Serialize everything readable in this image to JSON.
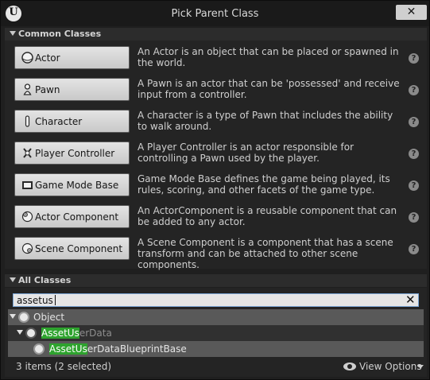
{
  "window": {
    "title": "Pick Parent Class",
    "close_glyph": "✕"
  },
  "icons": {
    "logo": "unreal-logo-icon",
    "help": "question-icon"
  },
  "common": {
    "header": "Common Classes",
    "items": [
      {
        "label": "Actor",
        "desc": "An Actor is an object that can be placed or spawned in the world.",
        "icon": "actor-sphere-icon"
      },
      {
        "label": "Pawn",
        "desc": "A Pawn is an actor that can be 'possessed' and receive input from a controller.",
        "icon": "pawn-icon"
      },
      {
        "label": "Character",
        "desc": "A character is a type of Pawn that includes the ability to walk around.",
        "icon": "character-icon"
      },
      {
        "label": "Player Controller",
        "desc": "A Player Controller is an actor responsible for controlling a Pawn used by the player.",
        "icon": "player-controller-icon"
      },
      {
        "label": "Game Mode Base",
        "desc": "Game Mode Base defines the game being played, its rules, scoring, and other facets of the game type.",
        "icon": "game-mode-icon"
      },
      {
        "label": "Actor Component",
        "desc": "An ActorComponent is a reusable component that can be added to any actor.",
        "icon": "actor-component-icon"
      },
      {
        "label": "Scene Component",
        "desc": "A Scene Component is a component that has a scene transform and can be attached to other scene components.",
        "icon": "scene-component-icon"
      }
    ]
  },
  "all": {
    "header": "All Classes",
    "search_value": "assetus",
    "tree": {
      "object": "Object",
      "child": {
        "match": "AssetUs",
        "rest": "erData"
      },
      "grandchild": {
        "match": "AssetUs",
        "rest": "erDataBlueprintBase"
      }
    },
    "status": "3 items (2 selected)",
    "view_options": "View Options"
  }
}
